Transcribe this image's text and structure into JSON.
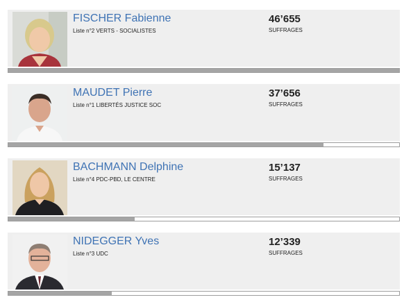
{
  "candidates": [
    {
      "name": "FISCHER Fabienne",
      "liste": "Liste n°2 VERTS - SOCIALISTES",
      "votes": "46’655",
      "votes_label": "SUFFRAGES",
      "progress": 1.0
    },
    {
      "name": "MAUDET Pierre",
      "liste": "Liste n°1 LIBERTÉS JUSTICE SOC",
      "votes": "37’656",
      "votes_label": "SUFFRAGES",
      "progress": 0.807
    },
    {
      "name": "BACHMANN Delphine",
      "liste": "Liste n°4 PDC-PBD, LE CENTRE",
      "votes": "15’137",
      "votes_label": "SUFFRAGES",
      "progress": 0.324
    },
    {
      "name": "NIDEGGER Yves",
      "liste": "Liste n°3 UDC",
      "votes": "12’339",
      "votes_label": "SUFFRAGES",
      "progress": 0.264
    }
  ],
  "colors": {
    "name": "#3f73b4",
    "bar_fill": "#a5a5a5",
    "card_bg": "#efefef"
  }
}
